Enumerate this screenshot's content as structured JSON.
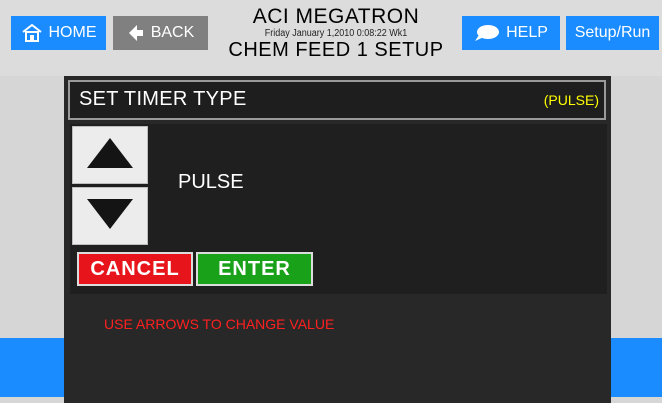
{
  "header": {
    "title": "ACI MEGATRON",
    "datetime": "Friday January 1,2010 0:08:22 Wk1",
    "subtitle": "CHEM FEED 1 SETUP",
    "home_label": "HOME",
    "back_label": "BACK",
    "help_label": "HELP",
    "setup_run_label": "Setup/Run"
  },
  "dialog": {
    "title": "SET TIMER TYPE",
    "current_badge": "(PULSE)",
    "value": "PULSE",
    "cancel_label": "CANCEL",
    "enter_label": "ENTER",
    "instruction": "USE ARROWS TO CHANGE VALUE"
  },
  "colors": {
    "nav_blue": "#1a8cff",
    "back_gray": "#808080",
    "cancel_red": "#e8141c",
    "enter_green": "#1aa11a",
    "badge_yellow": "#ffff00",
    "instruction_red": "#ff2020"
  },
  "icons": {
    "home": "home-icon",
    "back": "back-arrow-icon",
    "help": "speech-bubble-icon",
    "up": "up-triangle-icon",
    "down": "down-triangle-icon"
  }
}
